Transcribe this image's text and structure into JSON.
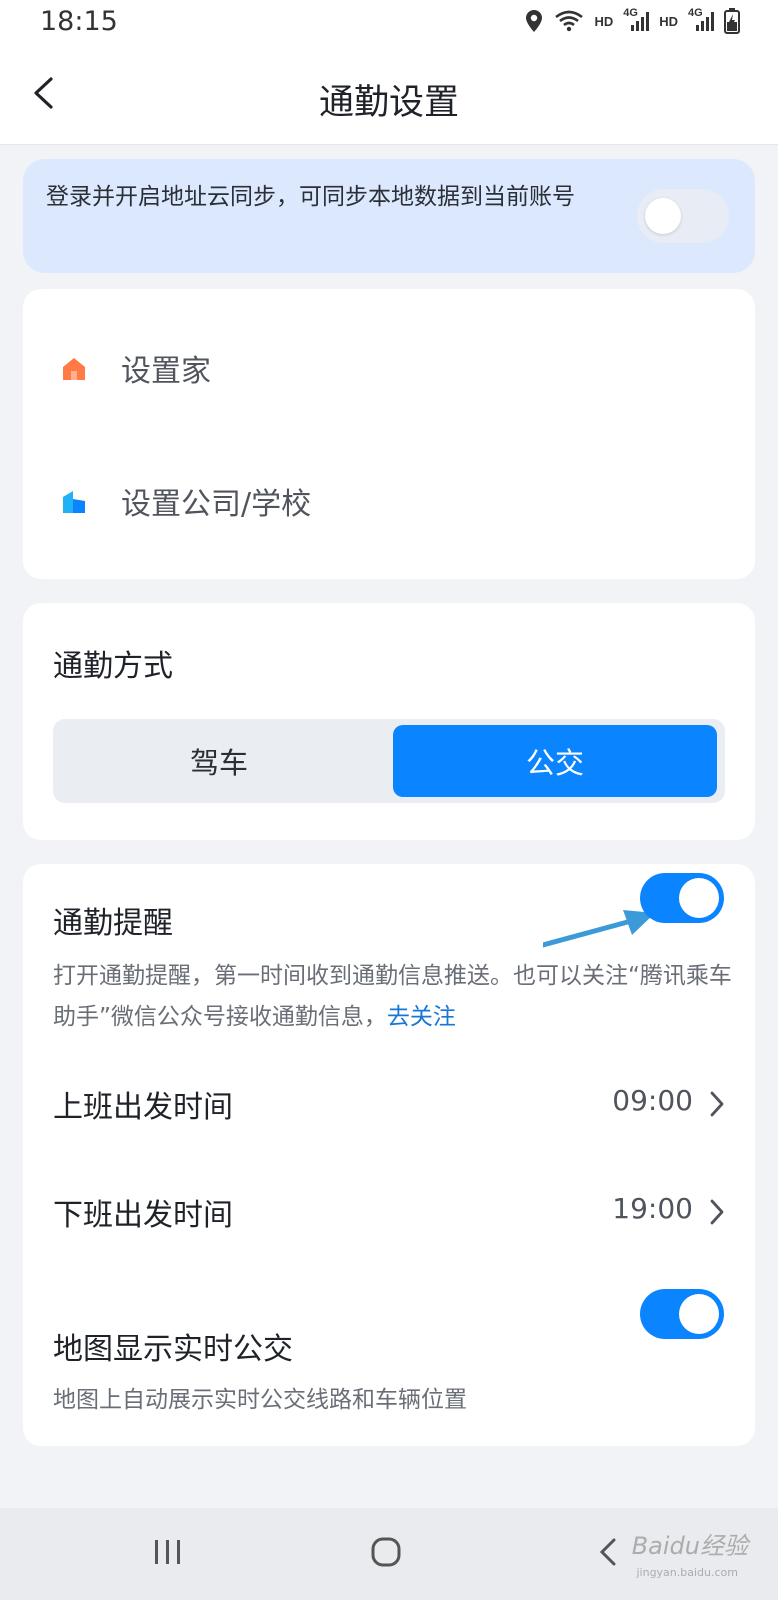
{
  "status_bar": {
    "time": "18:15",
    "hd1": "HD",
    "hd2": "HD",
    "net1": "4G",
    "net2": "4G",
    "icons": [
      "location-icon",
      "wifi-icon",
      "signal-icon",
      "battery-charging-icon"
    ]
  },
  "header": {
    "title": "通勤设置",
    "back_icon": "chevron-left-icon"
  },
  "sync_banner": {
    "text": "登录并开启地址云同步，可同步本地数据到当前账号",
    "toggle_on": false
  },
  "addresses": [
    {
      "label": "设置家",
      "icon": "home-icon",
      "color": "#ff7a45"
    },
    {
      "label": "设置公司/学校",
      "icon": "building-icon",
      "color": "#22b1f5"
    }
  ],
  "commute_mode": {
    "title": "通勤方式",
    "options": [
      "驾车",
      "公交"
    ],
    "selected": "公交"
  },
  "reminder": {
    "title": "通勤提醒",
    "toggle_on": true,
    "description": "打开通勤提醒，第一时间收到通勤信息推送。也可以关注“腾讯乘车助手”微信公众号接收通勤信息，",
    "link": "去关注"
  },
  "times": [
    {
      "label": "上班出发时间",
      "value": "09:00"
    },
    {
      "label": "下班出发时间",
      "value": "19:00"
    }
  ],
  "map_realtime": {
    "title": "地图显示实时公交",
    "description": "地图上自动展示实时公交线路和车辆位置",
    "toggle_on": true
  },
  "watermark": {
    "text": "Baidu经验",
    "sub": "jingyan.baidu.com"
  },
  "colors": {
    "accent": "#0a84ff",
    "banner": "#dce8fd",
    "link": "#1677d8"
  }
}
